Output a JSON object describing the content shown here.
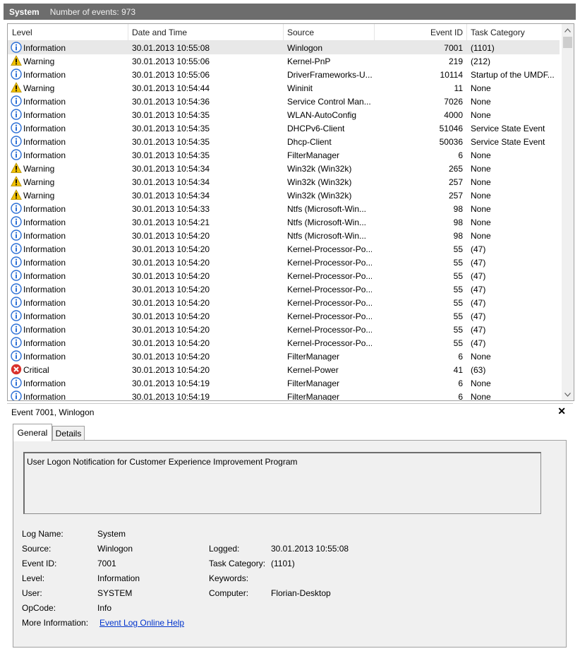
{
  "header": {
    "log_name": "System",
    "count_label": "Number of events: 973"
  },
  "columns": {
    "level": "Level",
    "date": "Date and Time",
    "source": "Source",
    "event_id": "Event ID",
    "task": "Task Category"
  },
  "rows": [
    {
      "level": "Information",
      "type": "info",
      "date": "30.01.2013 10:55:08",
      "source": "Winlogon",
      "id": "7001",
      "task": "(1101)",
      "selected": true
    },
    {
      "level": "Warning",
      "type": "warning",
      "date": "30.01.2013 10:55:06",
      "source": "Kernel-PnP",
      "id": "219",
      "task": "(212)"
    },
    {
      "level": "Information",
      "type": "info",
      "date": "30.01.2013 10:55:06",
      "source": "DriverFrameworks-U...",
      "id": "10114",
      "task": "Startup of the UMDF..."
    },
    {
      "level": "Warning",
      "type": "warning",
      "date": "30.01.2013 10:54:44",
      "source": "Wininit",
      "id": "11",
      "task": "None"
    },
    {
      "level": "Information",
      "type": "info",
      "date": "30.01.2013 10:54:36",
      "source": "Service Control Man...",
      "id": "7026",
      "task": "None"
    },
    {
      "level": "Information",
      "type": "info",
      "date": "30.01.2013 10:54:35",
      "source": "WLAN-AutoConfig",
      "id": "4000",
      "task": "None"
    },
    {
      "level": "Information",
      "type": "info",
      "date": "30.01.2013 10:54:35",
      "source": "DHCPv6-Client",
      "id": "51046",
      "task": "Service State Event"
    },
    {
      "level": "Information",
      "type": "info",
      "date": "30.01.2013 10:54:35",
      "source": "Dhcp-Client",
      "id": "50036",
      "task": "Service State Event"
    },
    {
      "level": "Information",
      "type": "info",
      "date": "30.01.2013 10:54:35",
      "source": "FilterManager",
      "id": "6",
      "task": "None"
    },
    {
      "level": "Warning",
      "type": "warning",
      "date": "30.01.2013 10:54:34",
      "source": "Win32k (Win32k)",
      "id": "265",
      "task": "None"
    },
    {
      "level": "Warning",
      "type": "warning",
      "date": "30.01.2013 10:54:34",
      "source": "Win32k (Win32k)",
      "id": "257",
      "task": "None"
    },
    {
      "level": "Warning",
      "type": "warning",
      "date": "30.01.2013 10:54:34",
      "source": "Win32k (Win32k)",
      "id": "257",
      "task": "None"
    },
    {
      "level": "Information",
      "type": "info",
      "date": "30.01.2013 10:54:33",
      "source": "Ntfs (Microsoft-Win...",
      "id": "98",
      "task": "None"
    },
    {
      "level": "Information",
      "type": "info",
      "date": "30.01.2013 10:54:21",
      "source": "Ntfs (Microsoft-Win...",
      "id": "98",
      "task": "None"
    },
    {
      "level": "Information",
      "type": "info",
      "date": "30.01.2013 10:54:20",
      "source": "Ntfs (Microsoft-Win...",
      "id": "98",
      "task": "None"
    },
    {
      "level": "Information",
      "type": "info",
      "date": "30.01.2013 10:54:20",
      "source": "Kernel-Processor-Po...",
      "id": "55",
      "task": "(47)"
    },
    {
      "level": "Information",
      "type": "info",
      "date": "30.01.2013 10:54:20",
      "source": "Kernel-Processor-Po...",
      "id": "55",
      "task": "(47)"
    },
    {
      "level": "Information",
      "type": "info",
      "date": "30.01.2013 10:54:20",
      "source": "Kernel-Processor-Po...",
      "id": "55",
      "task": "(47)"
    },
    {
      "level": "Information",
      "type": "info",
      "date": "30.01.2013 10:54:20",
      "source": "Kernel-Processor-Po...",
      "id": "55",
      "task": "(47)"
    },
    {
      "level": "Information",
      "type": "info",
      "date": "30.01.2013 10:54:20",
      "source": "Kernel-Processor-Po...",
      "id": "55",
      "task": "(47)"
    },
    {
      "level": "Information",
      "type": "info",
      "date": "30.01.2013 10:54:20",
      "source": "Kernel-Processor-Po...",
      "id": "55",
      "task": "(47)"
    },
    {
      "level": "Information",
      "type": "info",
      "date": "30.01.2013 10:54:20",
      "source": "Kernel-Processor-Po...",
      "id": "55",
      "task": "(47)"
    },
    {
      "level": "Information",
      "type": "info",
      "date": "30.01.2013 10:54:20",
      "source": "Kernel-Processor-Po...",
      "id": "55",
      "task": "(47)"
    },
    {
      "level": "Information",
      "type": "info",
      "date": "30.01.2013 10:54:20",
      "source": "FilterManager",
      "id": "6",
      "task": "None"
    },
    {
      "level": "Critical",
      "type": "critical",
      "date": "30.01.2013 10:54:20",
      "source": "Kernel-Power",
      "id": "41",
      "task": "(63)"
    },
    {
      "level": "Information",
      "type": "info",
      "date": "30.01.2013 10:54:19",
      "source": "FilterManager",
      "id": "6",
      "task": "None"
    },
    {
      "level": "Information",
      "type": "info",
      "date": "30.01.2013 10:54:19",
      "source": "FilterManager",
      "id": "6",
      "task": "None"
    }
  ],
  "detail": {
    "title": "Event 7001, Winlogon",
    "close_glyph": "✕",
    "tabs": {
      "general": "General",
      "details": "Details"
    },
    "description": "User Logon Notification for Customer Experience Improvement Program",
    "labels": {
      "log_name": "Log Name:",
      "source": "Source:",
      "event_id": "Event ID:",
      "level": "Level:",
      "user": "User:",
      "opcode": "OpCode:",
      "more_info": "More Information:",
      "logged": "Logged:",
      "task_category": "Task Category:",
      "keywords": "Keywords:",
      "computer": "Computer:"
    },
    "values": {
      "log_name": "System",
      "source": "Winlogon",
      "event_id": "7001",
      "level": "Information",
      "user": "SYSTEM",
      "opcode": "Info",
      "more_info_link": "Event Log Online Help",
      "logged": "30.01.2013 10:55:08",
      "task_category": "(1101)",
      "keywords": "",
      "computer": "Florian-Desktop"
    }
  },
  "colors": {
    "titlebar": "#6d6d6d",
    "info": "#2b6fd6",
    "warning": "#f2c200",
    "critical": "#d9302c",
    "link": "#0033cc"
  }
}
